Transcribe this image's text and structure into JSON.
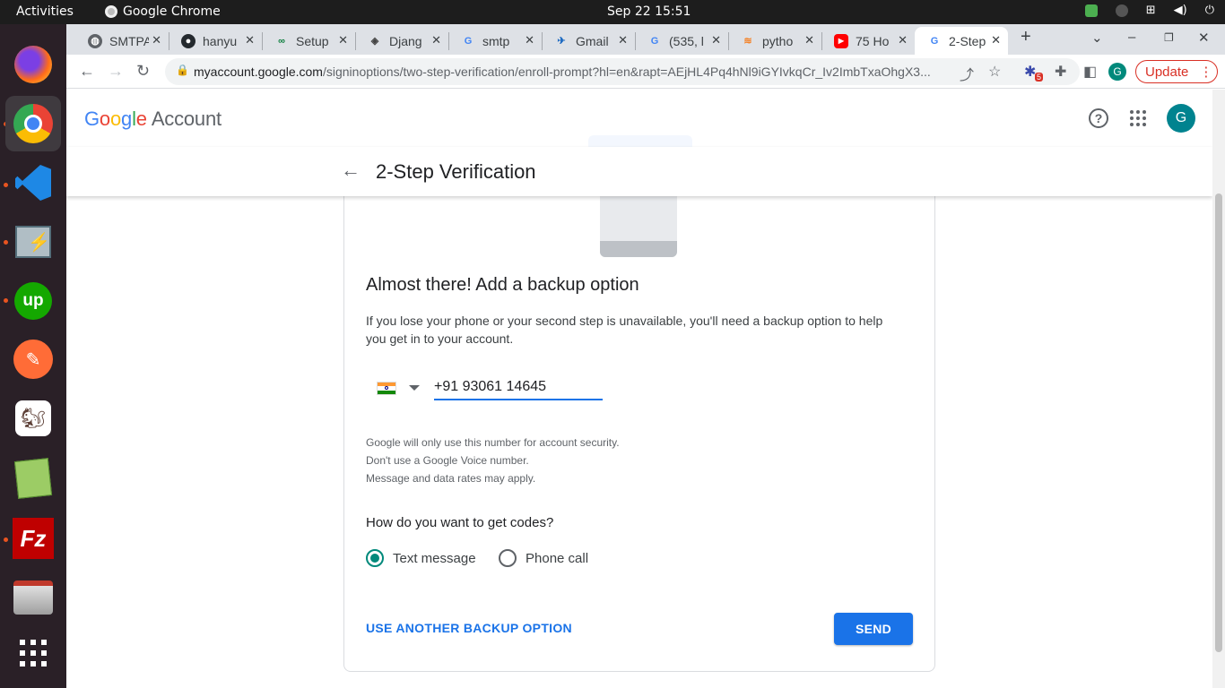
{
  "os_topbar": {
    "activities": "Activities",
    "app": "Google Chrome",
    "clock": "Sep 22  15:51"
  },
  "dock": {
    "apps": [
      "firefox-icon",
      "chrome-icon",
      "vscode-icon",
      "network-tool-icon",
      "upwork-icon",
      "postman-icon",
      "beekeeper-icon",
      "gedit-icon",
      "filezilla-icon",
      "files-icon",
      "app-grid-icon"
    ]
  },
  "tabs": [
    {
      "label": "SMTPA",
      "icon": "globe-icon"
    },
    {
      "label": "hanyu",
      "icon": "github-icon"
    },
    {
      "label": "Setup",
      "icon": "setup-icon"
    },
    {
      "label": "Djang",
      "icon": "django-icon"
    },
    {
      "label": "smtp",
      "icon": "google-icon"
    },
    {
      "label": "Gmail",
      "icon": "gmail-icon"
    },
    {
      "label": "(535, l",
      "icon": "google-icon"
    },
    {
      "label": "pytho",
      "icon": "stackoverflow-icon"
    },
    {
      "label": "75 Ho",
      "icon": "youtube-icon"
    },
    {
      "label": "2-Step",
      "icon": "google-icon",
      "active": true
    }
  ],
  "toolbar": {
    "url_host": "myaccount.google.com",
    "url_path": "/signinoptions/two-step-verification/enroll-prompt?hl=en&rapt=AEjHL4Pq4hNl9iGYIvkqCr_Iv2ImbTxaOhgX3...",
    "profile_initial": "G",
    "update_label": "Update",
    "extension_badge": "5"
  },
  "header": {
    "logo_google": "Google",
    "logo_account": "Account",
    "avatar_initial": "G"
  },
  "subheader": {
    "title": "2-Step Verification"
  },
  "card": {
    "title": "Almost there! Add a backup option",
    "description": "If you lose your phone or your second step is unavailable, you'll need a backup option to help you get in to your account.",
    "phone_value": "+91 93061 14645",
    "disclaimer_1": "Google will only use this number for account security.",
    "disclaimer_2": "Don't use a Google Voice number.",
    "disclaimer_3": "Message and data rates may apply.",
    "codes_question": "How do you want to get codes?",
    "option_text": "Text message",
    "option_call": "Phone call",
    "selected_option": "Text message",
    "another_option_label": "USE ANOTHER BACKUP OPTION",
    "send_label": "SEND"
  },
  "colors": {
    "accent": "#1a73e8",
    "radio_selected": "#00897b",
    "update": "#d93025"
  }
}
